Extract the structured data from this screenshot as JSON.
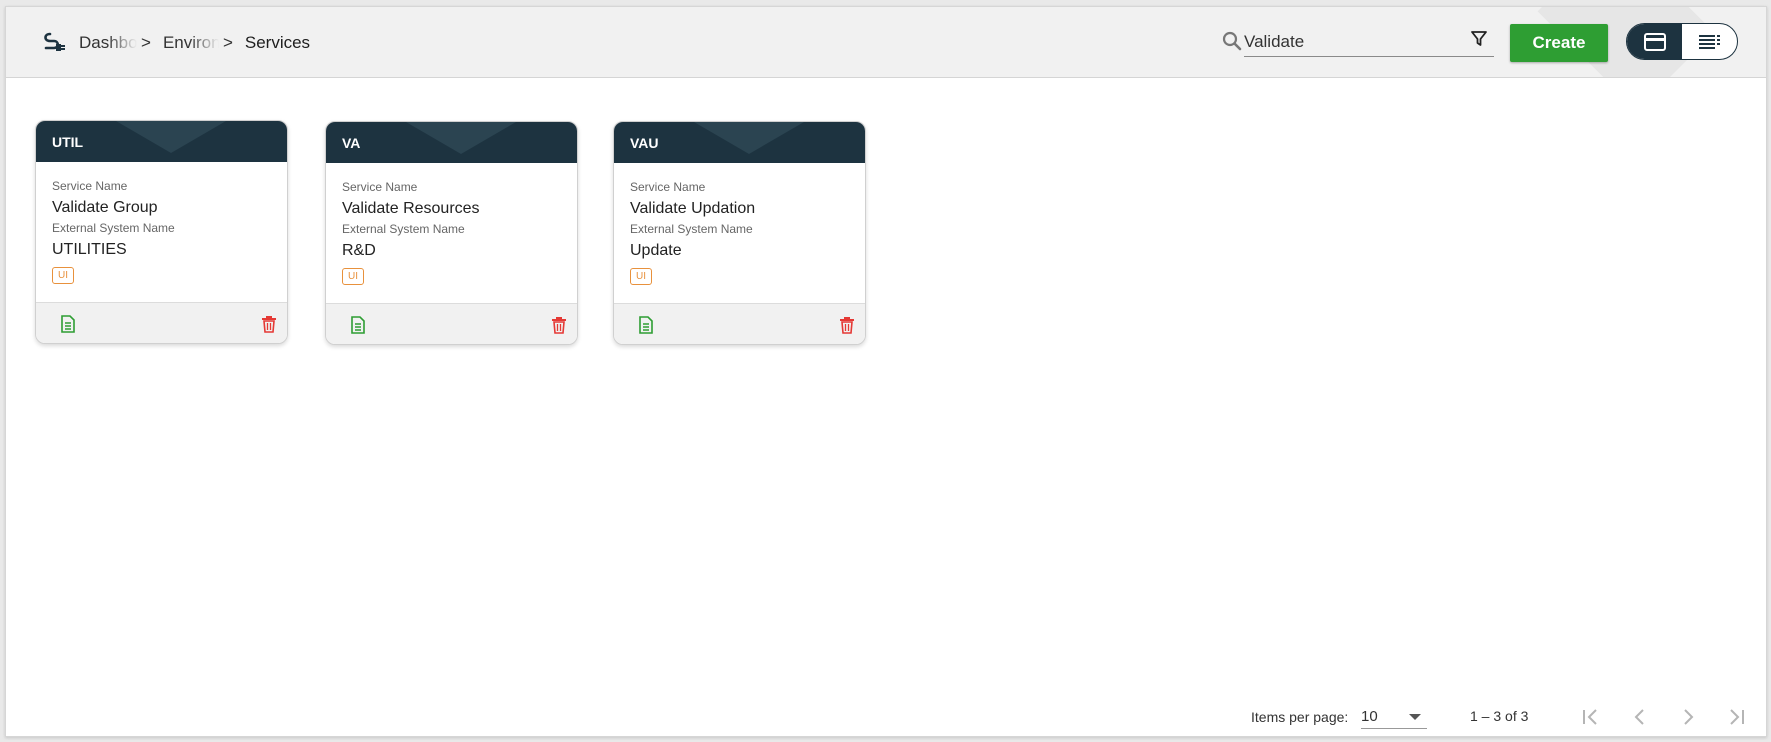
{
  "header": {
    "breadcrumbs": [
      {
        "label": "Dashboard"
      },
      {
        "label": "Environments"
      },
      {
        "label": "Services"
      }
    ],
    "separator": ">",
    "search": {
      "value": "Validate",
      "placeholder": ""
    },
    "create_label": "Create",
    "view_modes": [
      "card-view",
      "list-view"
    ],
    "active_view": "card-view"
  },
  "cards": [
    {
      "code": "UTIL",
      "service_name_label": "Service Name",
      "service_name": "Validate Group",
      "external_label": "External System Name",
      "external_name": "UTILITIES",
      "tag": "UI"
    },
    {
      "code": "VA",
      "service_name_label": "Service Name",
      "service_name": "Validate Resources",
      "external_label": "External System Name",
      "external_name": "R&D",
      "tag": "UI"
    },
    {
      "code": "VAU",
      "service_name_label": "Service Name",
      "service_name": "Validate Updation",
      "external_label": "External System Name",
      "external_name": "Update",
      "tag": "UI"
    }
  ],
  "paginator": {
    "items_per_page_label": "Items per page:",
    "items_per_page": "10",
    "range": "1 – 3 of 3"
  },
  "colors": {
    "accent_green": "#2e9e33",
    "card_header": "#1d3340",
    "tag_orange": "#e8913c",
    "delete_red": "#e53935"
  }
}
